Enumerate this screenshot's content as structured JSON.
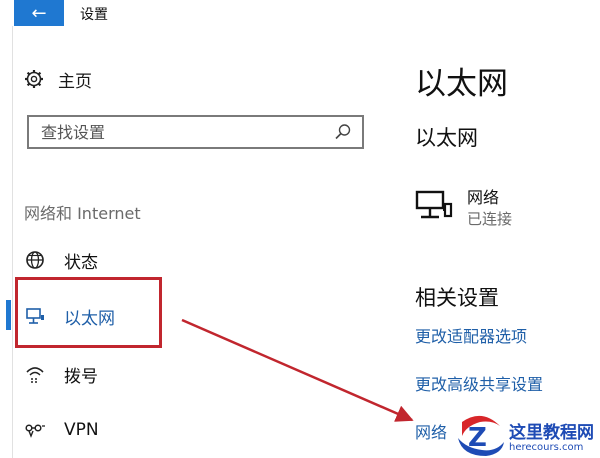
{
  "window": {
    "title": "设置",
    "back_icon": "back-arrow-icon"
  },
  "sidebar": {
    "home_label": "主页",
    "search": {
      "placeholder": "查找设置"
    },
    "section_heading": "网络和 Internet",
    "items": [
      {
        "label": "状态",
        "icon": "globe-icon"
      },
      {
        "label": "以太网",
        "icon": "ethernet-icon",
        "active": true
      },
      {
        "label": "拨号",
        "icon": "dialup-icon"
      },
      {
        "label": "VPN",
        "icon": "vpn-icon"
      }
    ]
  },
  "main": {
    "page_title": "以太网",
    "subtitle": "以太网",
    "network": {
      "name": "网络",
      "status": "已连接"
    },
    "related_title": "相关设置",
    "links": [
      "更改适配器选项",
      "更改高级共享设置",
      "网络"
    ]
  },
  "watermark": {
    "title": "这里教程网",
    "subtitle": "herecours.com"
  },
  "colors": {
    "accent": "#1f78d1",
    "link": "#1f5fa8",
    "annotation_red": "#c1262e"
  }
}
